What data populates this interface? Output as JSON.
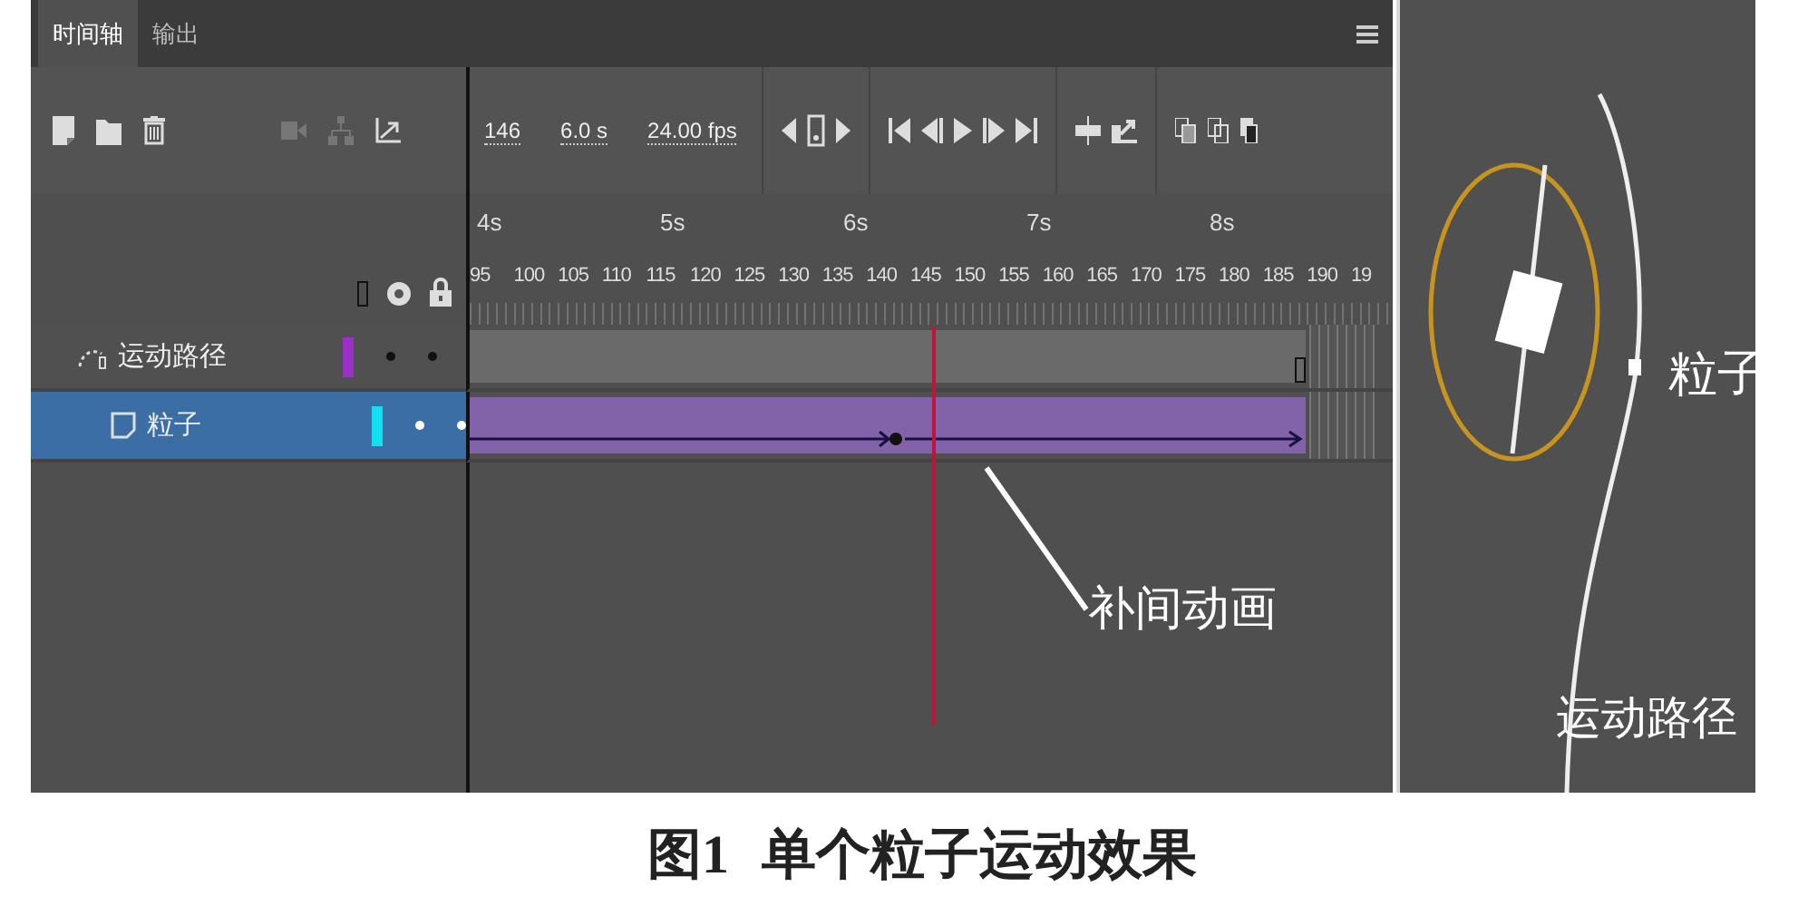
{
  "tabs": [
    {
      "label": "时间轴",
      "selected": true
    },
    {
      "label": "输出",
      "selected": false
    }
  ],
  "playback": {
    "frame": "146",
    "time": "6.0 s",
    "rate": "24.00 fps"
  },
  "ruler": {
    "seconds": [
      "4s",
      "5s",
      "6s",
      "7s",
      "8s"
    ],
    "frames": [
      "95",
      "100",
      "105",
      "110",
      "115",
      "120",
      "125",
      "130",
      "135",
      "140",
      "145",
      "150",
      "155",
      "160",
      "165",
      "170",
      "175",
      "180",
      "185",
      "190",
      "19"
    ]
  },
  "layers": [
    {
      "name": "运动路径",
      "kind": "guide",
      "color": "#9b30c8",
      "selected": false,
      "tween": false
    },
    {
      "name": "粒子",
      "kind": "normal",
      "color": "#10e0f0",
      "selected": true,
      "tween": true
    }
  ],
  "annotation": "补间动画",
  "stage": {
    "labels": [
      "粒子",
      "运动路径"
    ]
  },
  "caption": {
    "number": "图1",
    "text": "单个粒子运动效果"
  }
}
